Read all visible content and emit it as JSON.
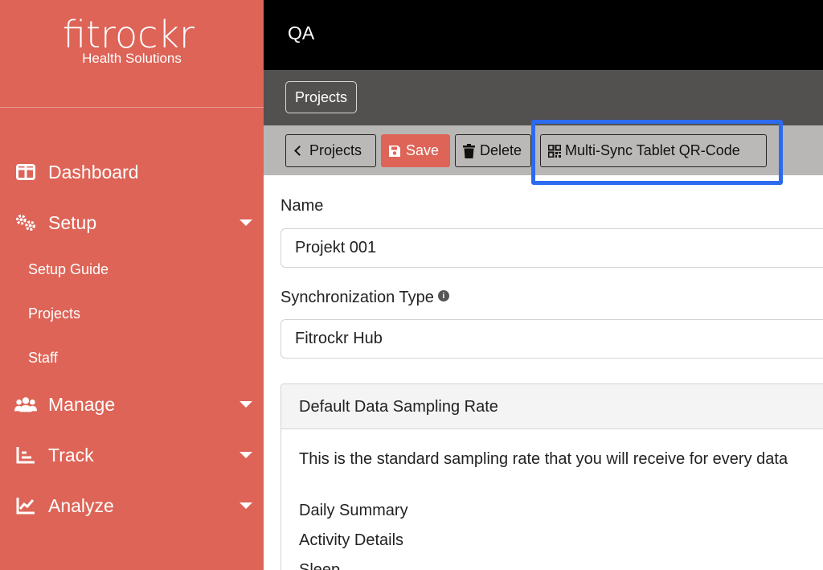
{
  "brand": {
    "name": "fitrockr",
    "tagline": "Health Solutions",
    "color": "#dd6457"
  },
  "sidebar": {
    "items": [
      {
        "label": "Dashboard",
        "icon": "dashboard-icon"
      },
      {
        "label": "Setup",
        "icon": "gears-icon",
        "expanded": true
      },
      {
        "label": "Manage",
        "icon": "users-icon"
      },
      {
        "label": "Track",
        "icon": "chart-bar-icon"
      },
      {
        "label": "Analyze",
        "icon": "chart-line-icon"
      }
    ],
    "setup_children": [
      "Setup Guide",
      "Projects",
      "Staff"
    ]
  },
  "header": {
    "title": "QA"
  },
  "breadcrumb": {
    "label": "Projects"
  },
  "toolbar": {
    "back_label": "Projects",
    "save_label": "Save",
    "delete_label": "Delete",
    "qr_label": "Multi-Sync Tablet QR-Code",
    "highlight_color": "#2c6af0"
  },
  "form": {
    "name_label": "Name",
    "name_value": "Projekt 001",
    "sync_label": "Synchronization Type",
    "sync_value": "Fitrockr Hub"
  },
  "sampling_card": {
    "title": "Default Data Sampling Rate",
    "description": "This is the standard sampling rate that you will receive for every data",
    "items": [
      "Daily Summary",
      "Activity Details",
      "Sleep"
    ]
  }
}
